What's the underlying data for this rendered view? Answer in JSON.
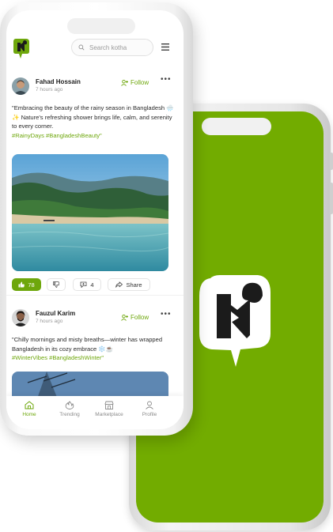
{
  "search": {
    "placeholder": "Search kotha"
  },
  "posts": [
    {
      "author": "Fahad Hossain",
      "time": "7 hours ago",
      "follow_label": "Follow",
      "text": "\"Embracing the beauty of the rainy season in Bangladesh 🌧️✨ Nature's refreshing shower brings life, calm, and serenity to every corner.",
      "tags": "#RainyDays #BangladeshBeauty\"",
      "likes": "78",
      "comments": "4",
      "share_label": "Share"
    },
    {
      "author": "Fauzul Karim",
      "time": "7 hours ago",
      "follow_label": "Follow",
      "text": "\"Chilly mornings and misty breaths—winter has wrapped Bangladesh in its cozy embrace ❄️☕",
      "tags": "#WinterVibes #BangladeshWinter\""
    }
  ],
  "nav": [
    {
      "label": "Home",
      "icon": "home-icon",
      "active": true
    },
    {
      "label": "Trending",
      "icon": "trending-icon"
    },
    {
      "label": "Marketplace",
      "icon": "marketplace-icon"
    },
    {
      "label": "Profile",
      "icon": "profile-icon"
    }
  ],
  "colors": {
    "brand_green": "#72ac00",
    "accent": "#6ea70c"
  }
}
